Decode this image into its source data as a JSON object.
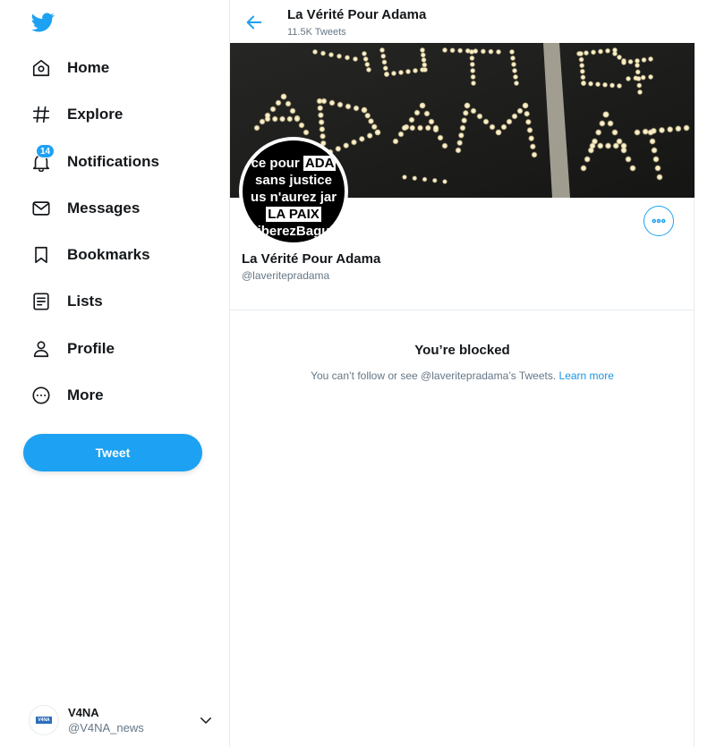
{
  "sidebar": {
    "logo": "twitter-bird-icon",
    "items": [
      {
        "label": "Home",
        "icon": "home-icon"
      },
      {
        "label": "Explore",
        "icon": "hashtag-icon"
      },
      {
        "label": "Notifications",
        "icon": "bell-icon",
        "badge": "14"
      },
      {
        "label": "Messages",
        "icon": "envelope-icon"
      },
      {
        "label": "Bookmarks",
        "icon": "bookmark-icon"
      },
      {
        "label": "Lists",
        "icon": "list-icon"
      },
      {
        "label": "Profile",
        "icon": "person-icon"
      },
      {
        "label": "More",
        "icon": "more-circle-icon"
      }
    ],
    "tweet_label": "Tweet",
    "account": {
      "name": "V4NA",
      "handle": "@V4NA_news",
      "avatar_text": "V4NA"
    }
  },
  "header": {
    "title": "La Vérité Pour Adama",
    "subtitle": "11.5K Tweets"
  },
  "banner": {
    "candle_text_line1": "JUSTICE",
    "candle_text_line2": "ADAMA"
  },
  "profile": {
    "avatar_lines": [
      "ce pour ADA",
      "sans justice",
      "us n'aurez jar",
      "LA PAIX",
      "iberezBagu"
    ],
    "name": "La Vérité Pour Adama",
    "handle": "@laveritepradama"
  },
  "blocked": {
    "title": "You’re blocked",
    "message": "You can’t follow or see @laveritepradama’s Tweets.",
    "link": "Learn more"
  },
  "colors": {
    "accent": "#1da1f2",
    "text": "#14171a",
    "muted": "#657786",
    "border": "#e6ecf0"
  }
}
